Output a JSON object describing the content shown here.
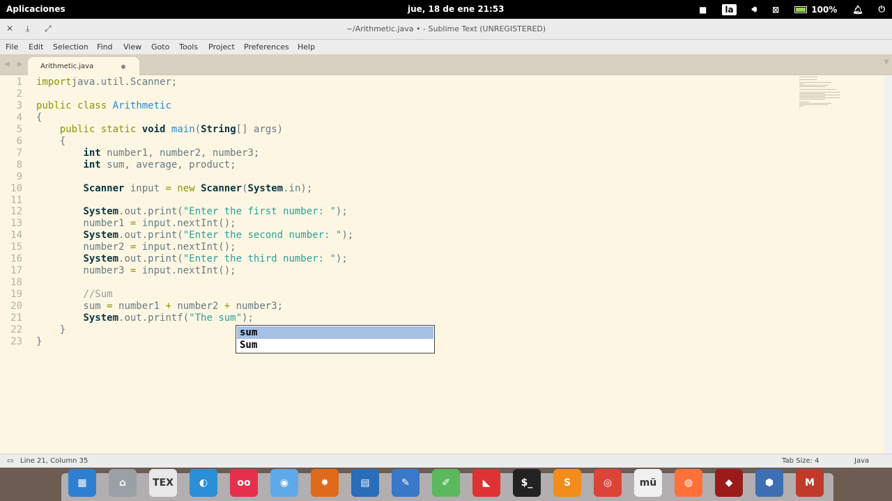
{
  "system_bar": {
    "apps_label": "Aplicaciones",
    "clock": "jue, 18 de ene   21:53",
    "keyboard_layout": "la",
    "battery": "100%"
  },
  "window": {
    "title": "~/Arithmetic.java • - Sublime Text (UNREGISTERED)"
  },
  "menu": {
    "items": [
      "File",
      "Edit",
      "Selection",
      "Find",
      "View",
      "Goto",
      "Tools",
      "Project",
      "Preferences",
      "Help"
    ]
  },
  "tab": {
    "label": "Arithmetic.java"
  },
  "editor": {
    "lines": [
      [
        [
          "kw",
          "import"
        ],
        [
          "",
          "java.util.Scanner;"
        ]
      ],
      [],
      [
        [
          "kw",
          "public"
        ],
        [
          "",
          " "
        ],
        [
          "kw",
          "class"
        ],
        [
          "",
          " "
        ],
        [
          "ty",
          "Arithmetic"
        ]
      ],
      [
        [
          "",
          "{"
        ]
      ],
      [
        [
          "",
          "    "
        ],
        [
          "kw",
          "public"
        ],
        [
          "",
          " "
        ],
        [
          "kw",
          "static"
        ],
        [
          "",
          " "
        ],
        [
          "kw2",
          "void"
        ],
        [
          "",
          " "
        ],
        [
          "ty",
          "main"
        ],
        [
          "",
          "("
        ],
        [
          "kw2",
          "String"
        ],
        [
          "",
          "[] args)"
        ]
      ],
      [
        [
          "",
          "    {"
        ]
      ],
      [
        [
          "",
          "        "
        ],
        [
          "kw2",
          "int"
        ],
        [
          "",
          " number1, number2, number3;"
        ]
      ],
      [
        [
          "",
          "        "
        ],
        [
          "kw2",
          "int"
        ],
        [
          "",
          " sum, average, product;"
        ]
      ],
      [],
      [
        [
          "",
          "        "
        ],
        [
          "kw2",
          "Scanner"
        ],
        [
          "",
          " input "
        ],
        [
          "op",
          "="
        ],
        [
          "",
          " "
        ],
        [
          "kw",
          "new"
        ],
        [
          "",
          " "
        ],
        [
          "kw2",
          "Scanner"
        ],
        [
          "",
          "("
        ],
        [
          "kw2",
          "System"
        ],
        [
          "",
          ".in);"
        ]
      ],
      [],
      [
        [
          "",
          "        "
        ],
        [
          "kw2",
          "System"
        ],
        [
          "",
          ".out.print("
        ],
        [
          "str",
          "\"Enter the first number: \""
        ],
        [
          "",
          ");"
        ]
      ],
      [
        [
          "",
          "        number1 "
        ],
        [
          "op",
          "="
        ],
        [
          "",
          " input.nextInt();"
        ]
      ],
      [
        [
          "",
          "        "
        ],
        [
          "kw2",
          "System"
        ],
        [
          "",
          ".out.print("
        ],
        [
          "str",
          "\"Enter the second number: \""
        ],
        [
          "",
          ");"
        ]
      ],
      [
        [
          "",
          "        number2 "
        ],
        [
          "op",
          "="
        ],
        [
          "",
          " input.nextInt();"
        ]
      ],
      [
        [
          "",
          "        "
        ],
        [
          "kw2",
          "System"
        ],
        [
          "",
          ".out.print("
        ],
        [
          "str",
          "\"Enter the third number: \""
        ],
        [
          "",
          ");"
        ]
      ],
      [
        [
          "",
          "        number3 "
        ],
        [
          "op",
          "="
        ],
        [
          "",
          " input.nextInt();"
        ]
      ],
      [],
      [
        [
          "",
          "        "
        ],
        [
          "cm",
          "//Sum"
        ]
      ],
      [
        [
          "",
          "        sum "
        ],
        [
          "op",
          "="
        ],
        [
          "",
          " number1 "
        ],
        [
          "op",
          "+"
        ],
        [
          "",
          " number2 "
        ],
        [
          "op",
          "+"
        ],
        [
          "",
          " number3;"
        ]
      ],
      [
        [
          "",
          "        "
        ],
        [
          "kw2",
          "System"
        ],
        [
          "",
          ".out.printf("
        ],
        [
          "str",
          "\"The sum"
        ],
        [
          "str",
          "\""
        ],
        [
          "",
          ");"
        ]
      ],
      [
        [
          "",
          "    }"
        ]
      ],
      [
        [
          "",
          "}"
        ]
      ]
    ]
  },
  "autocomplete": {
    "options": [
      "sum",
      "Sum"
    ]
  },
  "status": {
    "position": "Line 21, Column 35",
    "tab_size": "Tab Size: 4",
    "syntax": "Java"
  },
  "dock": {
    "apps": [
      {
        "name": "workspaces-icon",
        "color": "#2f7fd1",
        "glyph": "▦"
      },
      {
        "name": "home-folder-icon",
        "color": "#9aa0a6",
        "glyph": "⌂"
      },
      {
        "name": "texmaker-icon",
        "color": "#e8e8e8",
        "glyph": "TEX"
      },
      {
        "name": "blender-like-icon",
        "color": "#2a8fd6",
        "glyph": "◐"
      },
      {
        "name": "circles-app-icon",
        "color": "#e5304d",
        "glyph": "oo"
      },
      {
        "name": "settings-toggle-icon",
        "color": "#5ea9e8",
        "glyph": "◉"
      },
      {
        "name": "burst-app-icon",
        "color": "#e06a1b",
        "glyph": "✸"
      },
      {
        "name": "document-viewer-icon",
        "color": "#2a6db8",
        "glyph": "▤"
      },
      {
        "name": "pen-tool-icon",
        "color": "#3a78c8",
        "glyph": "✎"
      },
      {
        "name": "text-editor-icon",
        "color": "#5cb85c",
        "glyph": "✐"
      },
      {
        "name": "red-app-icon",
        "color": "#d33",
        "glyph": "◣"
      },
      {
        "name": "terminal-icon",
        "color": "#222",
        "glyph": "$_"
      },
      {
        "name": "sublime-text-icon",
        "color": "#f28c1b",
        "glyph": "S"
      },
      {
        "name": "chrome-icon",
        "color": "#db4437",
        "glyph": "◎"
      },
      {
        "name": "mu-editor-icon",
        "color": "#f0f0f0",
        "glyph": "mü"
      },
      {
        "name": "firefox-icon",
        "color": "#ff7139",
        "glyph": "◍"
      },
      {
        "name": "ruby-app-icon",
        "color": "#9b1b1b",
        "glyph": "◆"
      },
      {
        "name": "virtualbox-icon",
        "color": "#3d6fb5",
        "glyph": "⬢"
      },
      {
        "name": "mendeley-icon",
        "color": "#c0392b",
        "glyph": "M"
      }
    ]
  }
}
